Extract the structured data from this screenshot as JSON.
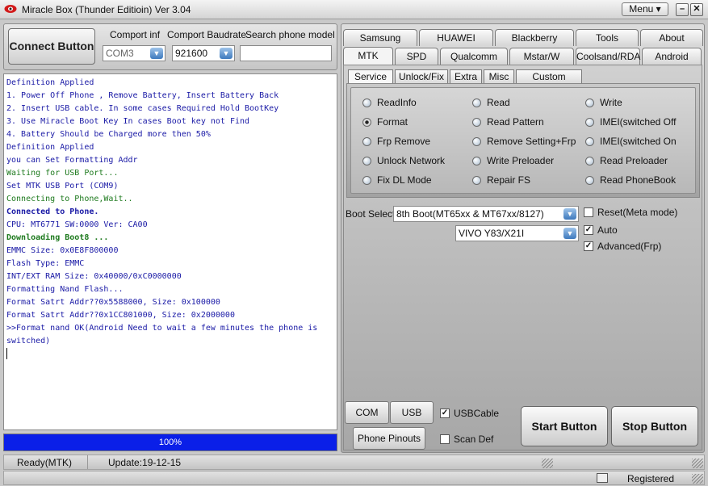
{
  "window": {
    "title": "Miracle Box (Thunder Editioin) Ver 3.04",
    "menu_label": "Menu"
  },
  "connect": {
    "button_label": "Connect Button",
    "comport_label": "Comport inf",
    "comport_value": "COM3",
    "baudrate_label": "Comport Baudrate",
    "baudrate_value": "921600",
    "search_label": "Search phone model",
    "search_value": ""
  },
  "log": {
    "lines": [
      {
        "text": " Definition Applied",
        "color": "#1a1aa6",
        "bold": false
      },
      {
        "text": " 1. Power Off Phone , Remove Battery, Insert Battery Back",
        "color": "#1a1aa6",
        "bold": false
      },
      {
        "text": " 2. Insert USB cable. In some cases Required Hold BootKey",
        "color": "#1a1aa6",
        "bold": false
      },
      {
        "text": " 3. Use Miracle Boot Key In cases Boot key not Find",
        "color": "#1a1aa6",
        "bold": false
      },
      {
        "text": " 4. Battery Should be Charged more then 50%",
        "color": "#1a1aa6",
        "bold": false
      },
      {
        "text": " Definition Applied",
        "color": "#1a1aa6",
        "bold": false
      },
      {
        "text": " you can Set Formatting Addr",
        "color": "#1a1aa6",
        "bold": false
      },
      {
        "text": " Waiting for USB Port...",
        "color": "#1e7a1e",
        "bold": false
      },
      {
        "text": " Set MTK USB Port (COM9)",
        "color": "#1a1aa6",
        "bold": false
      },
      {
        "text": " Connecting to Phone,Wait..",
        "color": "#1e7a1e",
        "bold": false
      },
      {
        "text": "  Connected to Phone.",
        "color": "#1a1aa6",
        "bold": true
      },
      {
        "text": " CPU: MT6771 SW:0000 Ver: CA00",
        "color": "#1a1aa6",
        "bold": false
      },
      {
        "text": "  Downloading Boot8 ...",
        "color": "#1e7a1e",
        "bold": true
      },
      {
        "text": " EMMC Size: 0x0E8F800000",
        "color": "#1a1aa6",
        "bold": false
      },
      {
        "text": " Flash Type: EMMC",
        "color": "#1a1aa6",
        "bold": false
      },
      {
        "text": " INT/EXT RAM  Size: 0x40000/0xC0000000",
        "color": "#1a1aa6",
        "bold": false
      },
      {
        "text": " Formatting Nand Flash...",
        "color": "#1a1aa6",
        "bold": false
      },
      {
        "text": " Format Satrt Addr??0x5588000, Size: 0x100000",
        "color": "#1a1aa6",
        "bold": false
      },
      {
        "text": " Format Satrt Addr??0x1CC801000, Size: 0x2000000",
        "color": "#1a1aa6",
        "bold": false
      },
      {
        "text": ">>Format nand OK(Android Need to wait a few minutes the phone is",
        "color": "#1a1aa6",
        "bold": false
      },
      {
        "text": "switched)",
        "color": "#1a1aa6",
        "bold": false
      }
    ]
  },
  "progress": {
    "label": "100%",
    "value": 1.0
  },
  "tabs": {
    "row1": [
      "Samsung",
      "HUAWEI",
      "Blackberry",
      "Tools",
      "About"
    ],
    "row2": [
      "MTK",
      "SPD",
      "Qualcomm",
      "Mstar/W",
      "Coolsand/RDA",
      "Android"
    ],
    "active": "MTK"
  },
  "subtabs": {
    "items": [
      "Service",
      "Unlock/Fix",
      "Extra",
      "Misc",
      "Custom Setting"
    ],
    "active": "Service"
  },
  "service": {
    "col1": [
      "ReadInfo",
      "Format",
      "Frp Remove",
      "Unlock Network",
      "Fix DL Mode"
    ],
    "col2": [
      "Read",
      "Read Pattern",
      "Remove Setting+Frp",
      "Write Preloader",
      "Repair FS"
    ],
    "col3": [
      "Write",
      "IMEI(switched Off",
      "IMEI(switched On",
      "Read Preloader",
      "Read PhoneBook"
    ],
    "selected": "Format"
  },
  "boot": {
    "label": "Boot Select:",
    "boot_value": "8th Boot(MT65xx & MT67xx/8127)",
    "model_value": "VIVO Y83/X21I"
  },
  "options": {
    "reset_label": "Reset(Meta mode)",
    "reset_checked": false,
    "auto_label": "Auto",
    "auto_checked": true,
    "advanced_label": "Advanced(Frp)",
    "advanced_checked": true
  },
  "bottom": {
    "com_scan": "COM Scan",
    "usb_scan": "USB Scan",
    "usb_cable_label": "USBCable",
    "usb_cable_checked": true,
    "phone_pinouts": "Phone Pinouts",
    "scan_def_label": "Scan Def",
    "scan_def_checked": false,
    "start": "Start Button",
    "stop": "Stop Button"
  },
  "status": {
    "state": "Ready(MTK)",
    "update": "Update:19-12-15",
    "registered": "Registered"
  },
  "colors": {
    "progress_fill": "#0a1fe8",
    "log_blue": "#1a1aa6",
    "log_green": "#1e7a1e"
  }
}
